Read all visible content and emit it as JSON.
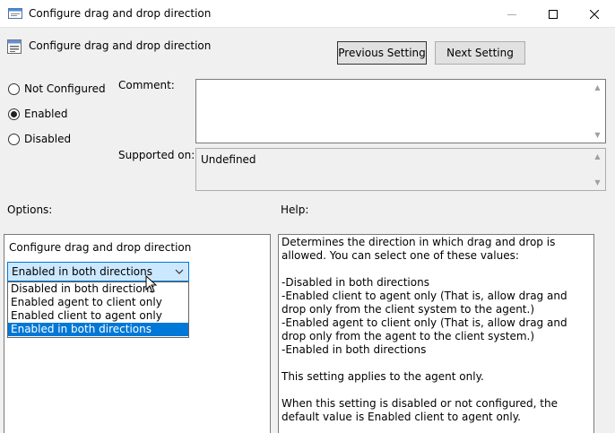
{
  "window": {
    "title": "Configure drag and drop direction",
    "icon": "policy-window-icon"
  },
  "header": {
    "title": "Configure drag and drop direction",
    "icon": "policy-setting-icon",
    "prev_button": "Previous Setting",
    "next_button": "Next Setting"
  },
  "state": {
    "options": [
      {
        "label": "Not Configured",
        "selected": false
      },
      {
        "label": "Enabled",
        "selected": true
      },
      {
        "label": "Disabled",
        "selected": false
      }
    ]
  },
  "comment": {
    "label": "Comment:",
    "value": ""
  },
  "supported": {
    "label": "Supported on:",
    "value": "Undefined"
  },
  "options_panel": {
    "heading": "Options:",
    "setting_label": "Configure drag and drop direction",
    "selected_value": "Enabled in both directions",
    "dropdown_items": [
      {
        "label": "Disabled in both directions",
        "selected": false
      },
      {
        "label": "Enabled agent to client only",
        "selected": false
      },
      {
        "label": "Enabled client to agent only",
        "selected": false
      },
      {
        "label": "Enabled in both directions",
        "selected": true
      }
    ]
  },
  "help": {
    "heading": "Help:",
    "paragraphs": [
      "Determines the direction in which drag and drop is allowed. You can select one of these values:",
      "-Disabled in both directions\n-Enabled client to agent only (That is, allow drag and drop only from the client system to the agent.)\n-Enabled agent to client only (That is, allow drag and drop only from the agent to the client system.)\n-Enabled in both directions",
      "This setting applies to the agent only.",
      "When this setting is disabled or not configured, the default value is Enabled client to agent only."
    ]
  },
  "colors": {
    "accent": "#0078d7",
    "selection_bg": "#cce8ff",
    "window_bg": "#f0f0f0"
  }
}
